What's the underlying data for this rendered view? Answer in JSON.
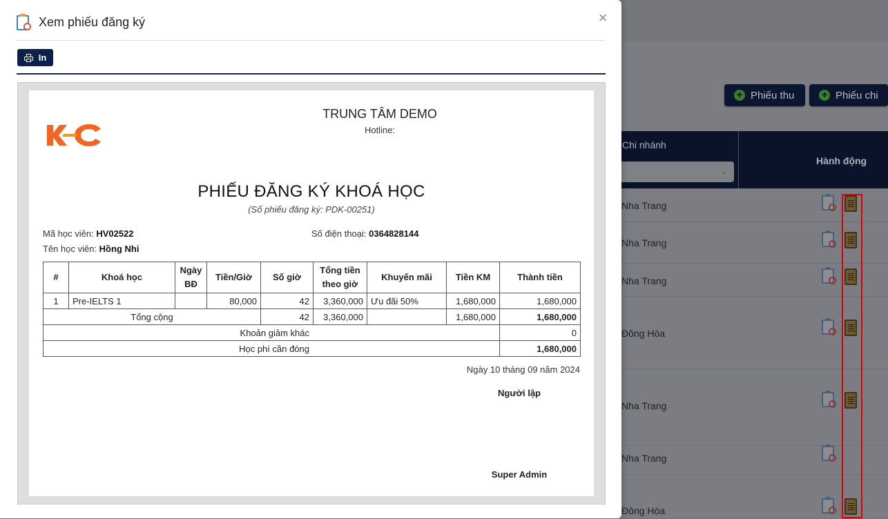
{
  "background": {
    "buttons": [
      {
        "label": "Phiếu thu"
      },
      {
        "label": "Phiếu chi"
      }
    ],
    "table": {
      "col_branch": "Chi nhánh",
      "col_action": "Hành động",
      "rows": [
        {
          "branch": "Nha Trang",
          "has_form_icon": true
        },
        {
          "branch": "Nha Trang",
          "has_form_icon": true
        },
        {
          "branch": "Nha Trang",
          "has_form_icon": true
        },
        {
          "branch": "Đông Hòa",
          "has_form_icon": true
        },
        {
          "branch": "Nha Trang",
          "has_form_icon": true
        },
        {
          "branch": "Nha Trang",
          "has_form_icon": false
        },
        {
          "branch": "Đông Hòa",
          "has_form_icon": true
        }
      ]
    },
    "highlight_color": "#e00000"
  },
  "modal": {
    "title": "Xem phiếu đăng ký",
    "close_glyph": "×",
    "print_label": "In"
  },
  "document": {
    "center_name": "TRUNG TÂM DEMO",
    "hotline": "Hotline:",
    "title": "PHIẾU ĐĂNG KÝ KHOÁ HỌC",
    "subtitle": "(Số phiếu đăng ký: PDK-00251)",
    "student_code_label": "Mã học viên:",
    "student_code": "HV02522",
    "phone_label": "Số điện thoại:",
    "phone": "0364828144",
    "student_name_label": "Tên học viên:",
    "student_name": "Hồng Nhi",
    "table": {
      "headers": {
        "no": "#",
        "course": "Khoá học",
        "start_date": "Ngày BĐ",
        "rate": "Tiền/Giờ",
        "hours": "Số giờ",
        "total_by_hour": "Tổng tiền theo giờ",
        "promotion": "Khuyến mãi",
        "promo_amount": "Tiền KM",
        "amount": "Thành tiền"
      },
      "rows": [
        {
          "no": "1",
          "course": "Pre-IELTS 1",
          "start_date": "",
          "rate": "80,000",
          "hours": "42",
          "total_by_hour": "3,360,000",
          "promotion": "Ưu đãi 50%",
          "promo_amount": "1,680,000",
          "amount": "1,680,000"
        }
      ],
      "total": {
        "label": "Tổng cộng",
        "hours": "42",
        "total_by_hour": "3,360,000",
        "promo_amount": "1,680,000",
        "amount": "1,680,000"
      },
      "other_discount": {
        "label": "Khoản giảm khác",
        "value": "0"
      },
      "payable": {
        "label": "Học phí cần đóng",
        "value": "1,680,000"
      }
    },
    "date_line": "Ngày 10 tháng 09 năm 2024",
    "creator_label": "Người lập",
    "creator_name": "Super Admin",
    "logo_color": "#f26522"
  }
}
